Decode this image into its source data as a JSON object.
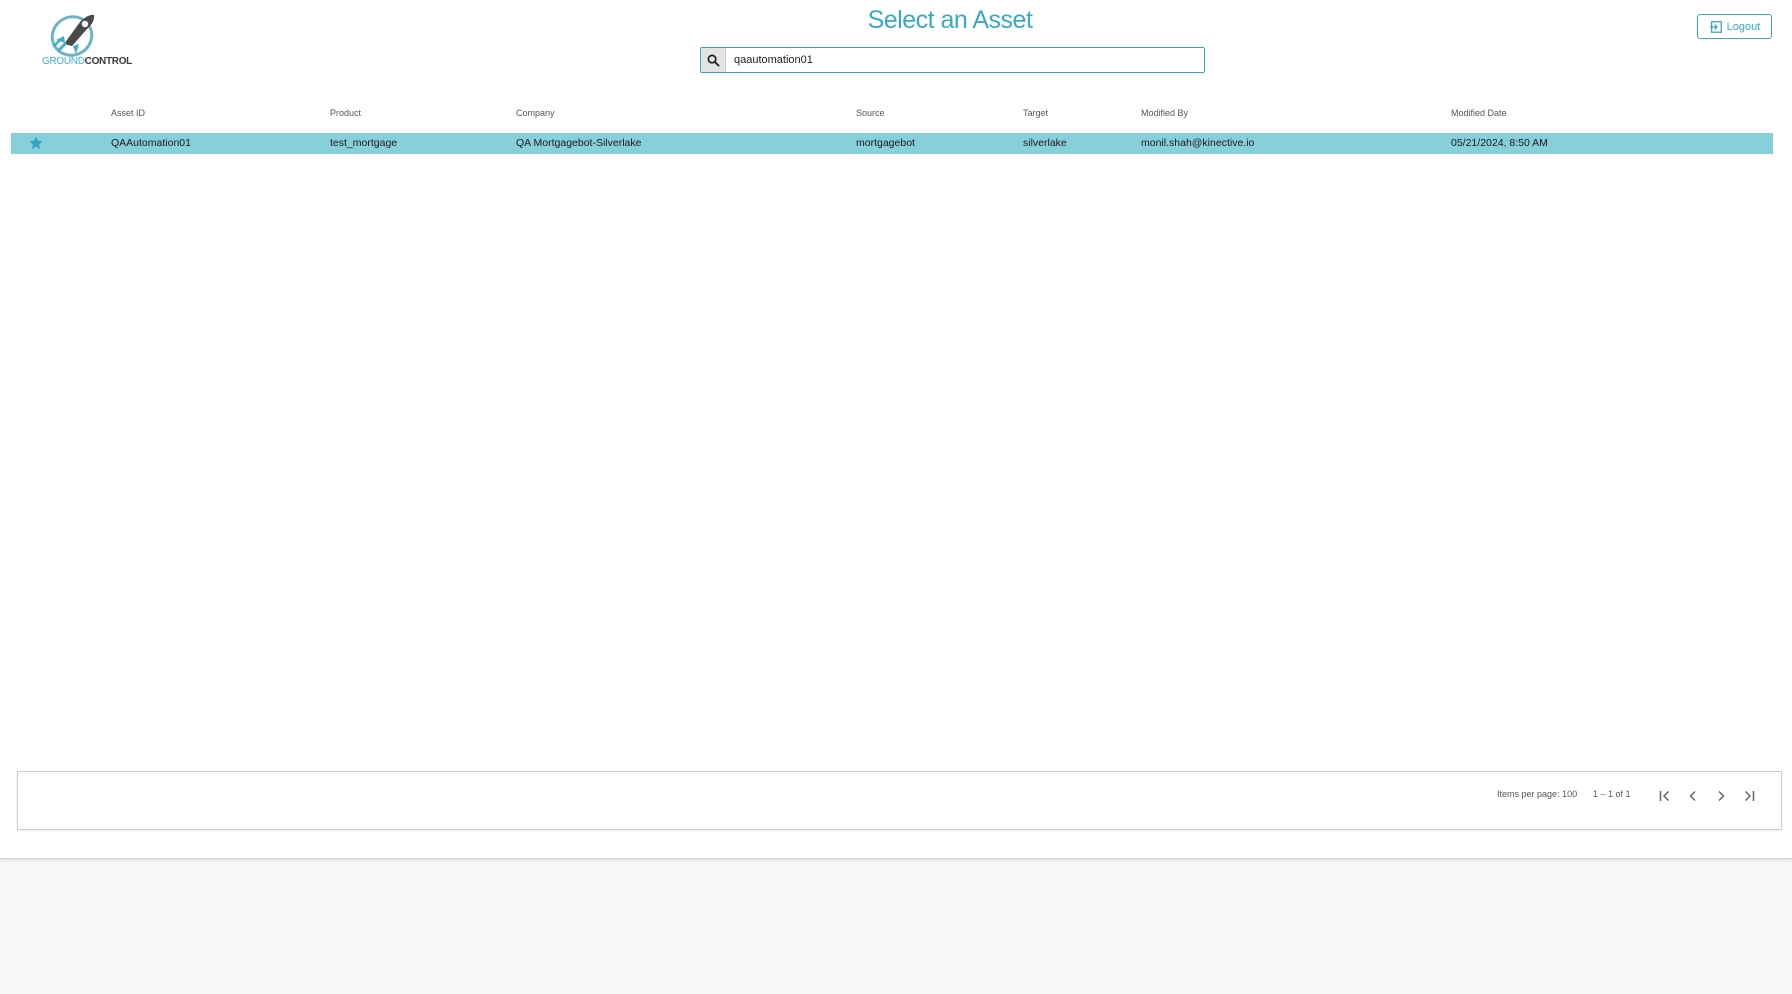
{
  "app": {
    "logo_text_part1": "GROUND",
    "logo_text_part2": "CONTROL",
    "title": "Select an Asset",
    "logout_label": "Logout",
    "accent_color": "#3aa9c3",
    "selected_row_color": "#88cfdc"
  },
  "search": {
    "value": "qaautomation01",
    "icon": "search-icon"
  },
  "table": {
    "columns": [
      "Asset ID",
      "Product",
      "Company",
      "Source",
      "Target",
      "Modified By",
      "Modified Date"
    ],
    "rows": [
      {
        "starred": true,
        "asset_id": "QAAutomation01",
        "product": "test_mortgage",
        "company": "QA Mortgagebot-Silverlake",
        "source": "mortgagebot",
        "target": "silverlake",
        "modified_by": "monil.shah@kinective.io",
        "modified_date": "05/21/2024, 8:50 AM"
      }
    ]
  },
  "paginator": {
    "items_per_page_label": "Items per page:",
    "items_per_page_value": "100",
    "range_label": "1 – 1 of 1",
    "buttons": [
      "first-page-icon",
      "previous-page-icon",
      "next-page-icon",
      "last-page-icon"
    ]
  }
}
